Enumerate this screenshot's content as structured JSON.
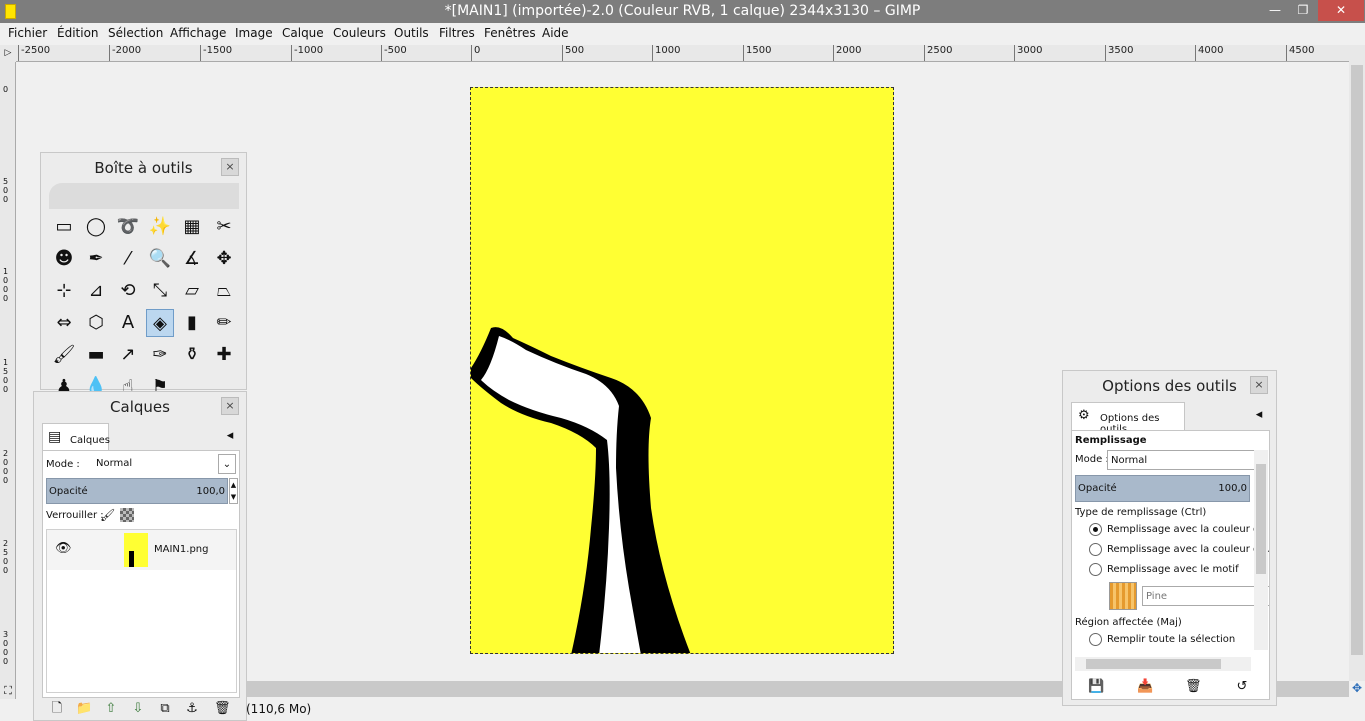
{
  "window": {
    "title": "*[MAIN1] (importée)-2.0 (Couleur RVB, 1 calque) 2344x3130 – GIMP",
    "min_glyph": "—",
    "max_glyph": "❐",
    "close_glyph": "✕"
  },
  "menu": [
    "Fichier",
    "Édition",
    "Sélection",
    "Affichage",
    "Image",
    "Calque",
    "Couleurs",
    "Outils",
    "Filtres",
    "Fenêtres",
    "Aide"
  ],
  "ruler": {
    "corner_glyph": "▷",
    "h_ticks": [
      "-2500",
      "-2000",
      "-1500",
      "-1000",
      "-500",
      "0",
      "500",
      "1000",
      "1500",
      "2000",
      "2500",
      "3000",
      "3500",
      "4000",
      "4500"
    ],
    "v_labels": [
      "0",
      "5 0 0",
      "1 0 0 0",
      "1 5 0 0",
      "2 0 0 0",
      "2 5 0 0",
      "3 0 0 0"
    ]
  },
  "statusbar": {
    "text": "(110,6 Mo)"
  },
  "toolbox": {
    "title": "Boîte à outils",
    "close_glyph": "×",
    "tools": [
      {
        "name": "rect-select",
        "glyph": "▭"
      },
      {
        "name": "ellipse-select",
        "glyph": "◯"
      },
      {
        "name": "free-select",
        "glyph": "➰"
      },
      {
        "name": "fuzzy-select",
        "glyph": "✨"
      },
      {
        "name": "color-select",
        "glyph": "▦"
      },
      {
        "name": "scissors",
        "glyph": "✂"
      },
      {
        "name": "foreground-select",
        "glyph": "☻"
      },
      {
        "name": "paths",
        "glyph": "✒"
      },
      {
        "name": "color-picker",
        "glyph": "⁄"
      },
      {
        "name": "zoom",
        "glyph": "🔍"
      },
      {
        "name": "measure",
        "glyph": "∡"
      },
      {
        "name": "move",
        "glyph": "✥"
      },
      {
        "name": "align",
        "glyph": "⊹"
      },
      {
        "name": "crop",
        "glyph": "⊿"
      },
      {
        "name": "rotate",
        "glyph": "⟲"
      },
      {
        "name": "scale",
        "glyph": "⤡"
      },
      {
        "name": "shear",
        "glyph": "▱"
      },
      {
        "name": "perspective",
        "glyph": "⏢"
      },
      {
        "name": "flip",
        "glyph": "⇔"
      },
      {
        "name": "cage",
        "glyph": "⬡"
      },
      {
        "name": "text",
        "glyph": "A"
      },
      {
        "name": "bucket-fill",
        "glyph": "◈"
      },
      {
        "name": "blend",
        "glyph": "▮"
      },
      {
        "name": "pencil",
        "glyph": "✏"
      },
      {
        "name": "paintbrush",
        "glyph": "🖌"
      },
      {
        "name": "eraser",
        "glyph": "▬"
      },
      {
        "name": "airbrush",
        "glyph": "↗"
      },
      {
        "name": "ink",
        "glyph": "✑"
      },
      {
        "name": "clone",
        "glyph": "⚱"
      },
      {
        "name": "heal",
        "glyph": "✚"
      },
      {
        "name": "perspective-clone",
        "glyph": "♟"
      },
      {
        "name": "blur",
        "glyph": "💧"
      },
      {
        "name": "smudge",
        "glyph": "☝"
      },
      {
        "name": "dodge-burn",
        "glyph": "⚑"
      }
    ]
  },
  "layers": {
    "title": "Calques",
    "close_glyph": "×",
    "tab_label": "Calques",
    "tab_menu_glyph": "◂",
    "mode_label": "Mode :",
    "mode_value": "Normal",
    "dropdown_glyph": "⌄",
    "opacity_label": "Opacité",
    "opacity_value": "100,0",
    "opacity_fraction": 1.0,
    "lock_label": "Verrouiller :",
    "eye_glyph": "👁",
    "layer_name": "MAIN1.png",
    "footer_glyphs": [
      "🗋",
      "📁",
      "⇧",
      "⇩",
      "⧉",
      "⚓",
      "🗑"
    ]
  },
  "tool_options": {
    "title": "Options des outils",
    "close_glyph": "×",
    "tab_label": "Options des outils",
    "section": "Remplissage",
    "mode_label": "Mode :",
    "mode_value": "Normal",
    "opacity_label": "Opacité",
    "opacity_value": "100,0",
    "fill_type_label": "Type de remplissage (Ctrl)",
    "fill_options": [
      "Remplissage avec la couleur de l",
      "Remplissage avec la couleur d'Al",
      "Remplissage avec le motif"
    ],
    "pattern_name": "Pine",
    "region_label": "Région affectée (Maj)",
    "region_options": [
      "Remplir toute la sélection"
    ],
    "footer_glyphs": [
      "💾",
      "📥",
      "🗑",
      "↺"
    ]
  },
  "colors": {
    "canvas_bg": "#ffff33",
    "close_button": "#c7504b",
    "active_tool": "#bcd7ef"
  }
}
